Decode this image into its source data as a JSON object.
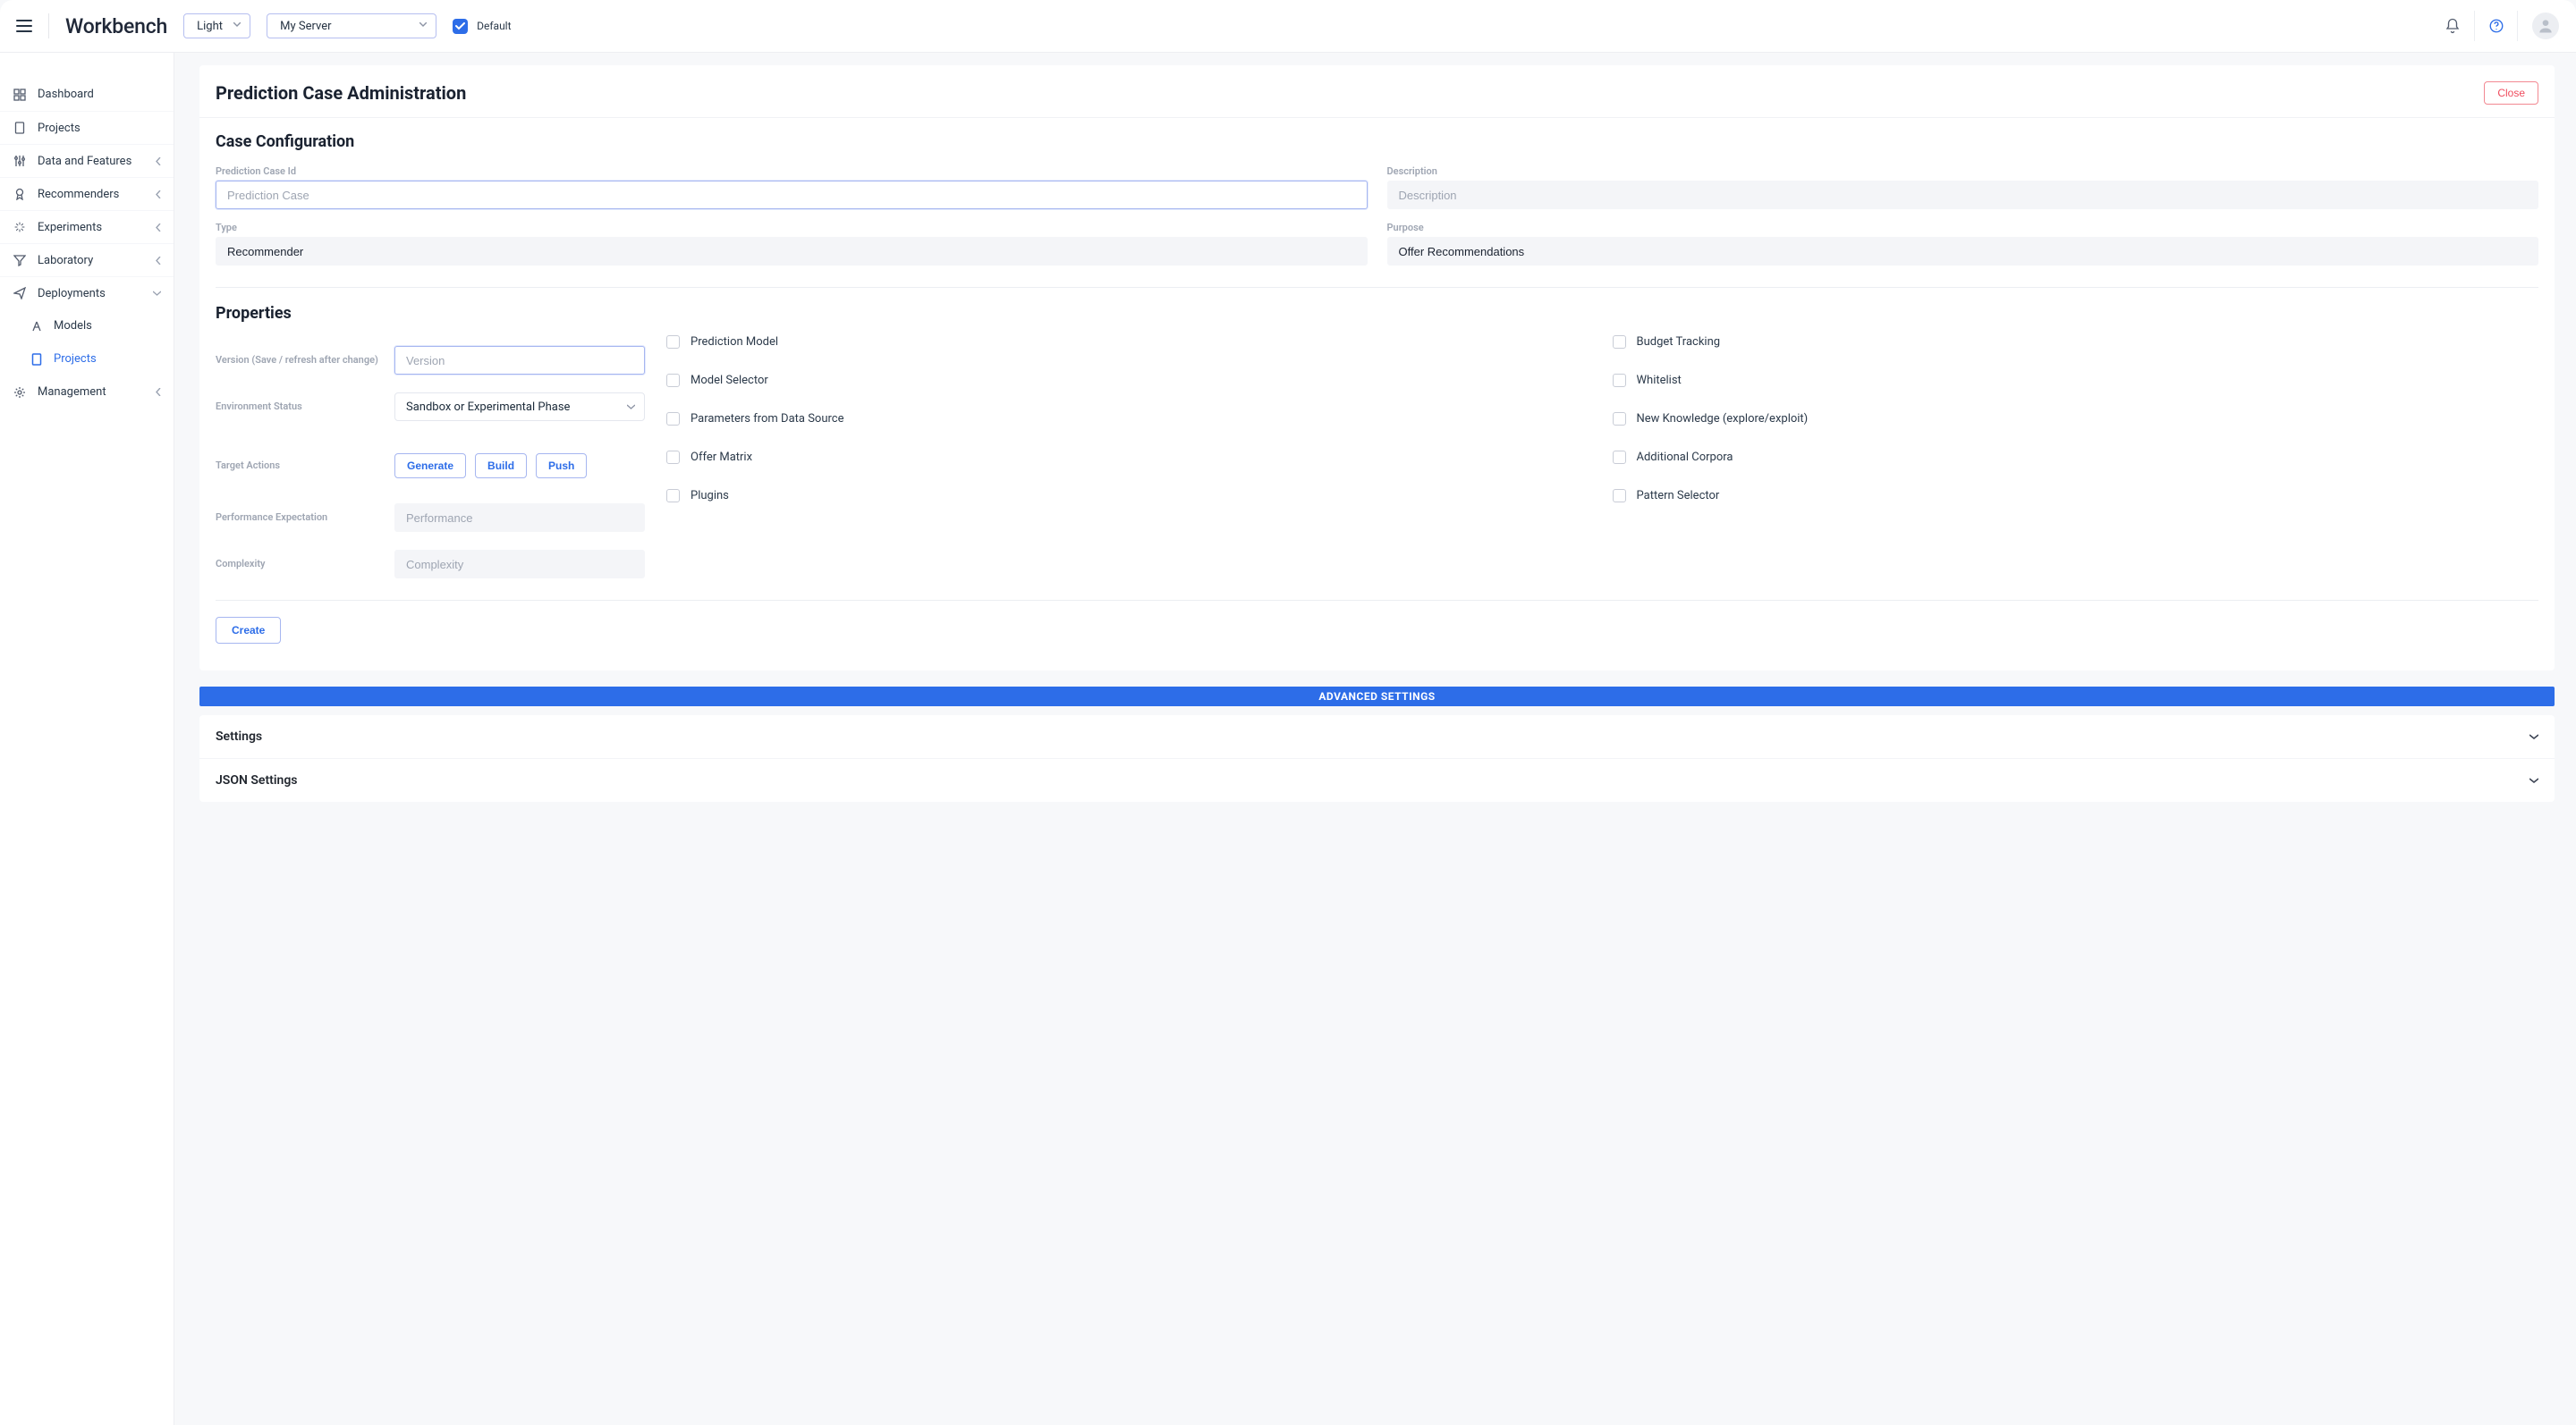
{
  "topbar": {
    "brand": "Workbench",
    "theme": "Light",
    "server": "My Server",
    "default_checked": true,
    "default_label": "Default"
  },
  "sidebar": {
    "items": [
      {
        "label": "Dashboard",
        "icon": "grid"
      },
      {
        "label": "Projects",
        "icon": "doc"
      },
      {
        "label": "Data and Features",
        "icon": "sliders",
        "expandable": true
      },
      {
        "label": "Recommenders",
        "icon": "badge",
        "expandable": true
      },
      {
        "label": "Experiments",
        "icon": "spark",
        "expandable": true
      },
      {
        "label": "Laboratory",
        "icon": "funnel",
        "expandable": true
      },
      {
        "label": "Deployments",
        "icon": "send",
        "expandable": true,
        "expanded": true
      },
      {
        "label": "Management",
        "icon": "gear",
        "expandable": true
      }
    ],
    "deployments_sub": [
      {
        "label": "Models",
        "icon": "A"
      },
      {
        "label": "Projects",
        "icon": "doc",
        "active": true
      }
    ]
  },
  "page": {
    "title": "Prediction Case Administration",
    "close": "Close",
    "case_config_title": "Case Configuration",
    "fields": {
      "case_id_label": "Prediction Case Id",
      "case_id_placeholder": "Prediction Case",
      "description_label": "Description",
      "description_placeholder": "Description",
      "type_label": "Type",
      "type_value": "Recommender",
      "purpose_label": "Purpose",
      "purpose_value": "Offer Recommendations"
    },
    "properties_title": "Properties",
    "props": {
      "version_label": "Version (Save / refresh after change)",
      "version_placeholder": "Version",
      "env_label": "Environment Status",
      "env_value": "Sandbox or Experimental Phase",
      "target_label": "Target Actions",
      "action_generate": "Generate",
      "action_build": "Build",
      "action_push": "Push",
      "perf_label": "Performance Expectation",
      "perf_placeholder": "Performance",
      "complexity_label": "Complexity",
      "complexity_placeholder": "Complexity"
    },
    "checkboxes_left": [
      "Prediction Model",
      "Model Selector",
      "Parameters from Data Source",
      "Offer Matrix",
      "Plugins"
    ],
    "checkboxes_right": [
      "Budget Tracking",
      "Whitelist",
      "New Knowledge (explore/exploit)",
      "Additional Corpora",
      "Pattern Selector"
    ],
    "create": "Create",
    "advanced_bar": "ADVANCED SETTINGS",
    "acc1": "Settings",
    "acc2": "JSON Settings"
  }
}
